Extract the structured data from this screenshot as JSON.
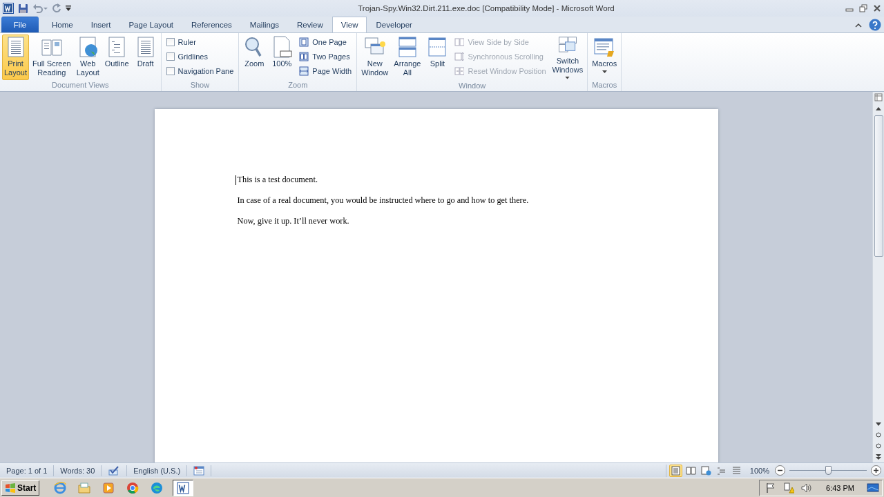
{
  "window": {
    "title": "Trojan-Spy.Win32.Dirt.211.exe.doc [Compatibility Mode]  -  Microsoft Word"
  },
  "tabs": [
    {
      "label": "File",
      "kind": "file",
      "selected": false
    },
    {
      "label": "Home",
      "kind": "tab",
      "selected": false
    },
    {
      "label": "Insert",
      "kind": "tab",
      "selected": false
    },
    {
      "label": "Page Layout",
      "kind": "tab",
      "selected": false
    },
    {
      "label": "References",
      "kind": "tab",
      "selected": false
    },
    {
      "label": "Mailings",
      "kind": "tab",
      "selected": false
    },
    {
      "label": "Review",
      "kind": "tab",
      "selected": false
    },
    {
      "label": "View",
      "kind": "tab",
      "selected": true
    },
    {
      "label": "Developer",
      "kind": "tab",
      "selected": false
    }
  ],
  "ribbon": {
    "groups": [
      {
        "label": "Document Views",
        "items": [
          {
            "kind": "large",
            "lines": [
              "Print",
              "Layout"
            ],
            "selected": true
          },
          {
            "kind": "large",
            "lines": [
              "Full Screen",
              "Reading"
            ],
            "selected": false
          },
          {
            "kind": "large",
            "lines": [
              "Web",
              "Layout"
            ],
            "selected": false
          },
          {
            "kind": "large",
            "lines": [
              "Outline"
            ],
            "selected": false
          },
          {
            "kind": "large",
            "lines": [
              "Draft"
            ],
            "selected": false
          }
        ]
      },
      {
        "label": "Show",
        "items": [
          {
            "kind": "check",
            "label": "Ruler",
            "checked": false
          },
          {
            "kind": "check",
            "label": "Gridlines",
            "checked": false
          },
          {
            "kind": "check",
            "label": "Navigation Pane",
            "checked": false
          }
        ]
      },
      {
        "label": "Zoom",
        "items": [
          {
            "kind": "large",
            "lines": [
              "Zoom"
            ],
            "selected": false
          },
          {
            "kind": "large",
            "lines": [
              "100%"
            ],
            "selected": false
          },
          {
            "kind": "small",
            "label": "One Page",
            "disabled": false
          },
          {
            "kind": "small",
            "label": "Two Pages",
            "disabled": false
          },
          {
            "kind": "small",
            "label": "Page Width",
            "disabled": false
          }
        ]
      },
      {
        "label": "Window",
        "items": [
          {
            "kind": "large",
            "lines": [
              "New",
              "Window"
            ],
            "selected": false
          },
          {
            "kind": "large",
            "lines": [
              "Arrange",
              "All"
            ],
            "selected": false
          },
          {
            "kind": "large",
            "lines": [
              "Split"
            ],
            "selected": false
          },
          {
            "kind": "small",
            "label": "View Side by Side",
            "disabled": true
          },
          {
            "kind": "small",
            "label": "Synchronous Scrolling",
            "disabled": true
          },
          {
            "kind": "small",
            "label": "Reset Window Position",
            "disabled": true
          },
          {
            "kind": "large",
            "lines": [
              "Switch",
              "Windows"
            ],
            "selected": false,
            "dropdown": true
          }
        ]
      },
      {
        "label": "Macros",
        "items": [
          {
            "kind": "large",
            "lines": [
              "Macros"
            ],
            "selected": false,
            "dropdown": true
          }
        ]
      }
    ]
  },
  "document": {
    "paragraphs": [
      "This is a test document.",
      "In case of a real  document, you would be instructed where to go and how to get there.",
      "Now,  give it up. It’ll never work."
    ]
  },
  "status_bar": {
    "page": "Page: 1 of 1",
    "words": "Words: 30",
    "language": "English (U.S.)",
    "views": [
      {
        "selected": true
      },
      {
        "selected": false
      },
      {
        "selected": false
      },
      {
        "selected": false
      },
      {
        "selected": false
      }
    ],
    "zoom": {
      "reading": "100%",
      "level": 0.5
    }
  },
  "taskbar": {
    "start": "Start",
    "apps": [
      {
        "selected": false
      },
      {
        "selected": false
      },
      {
        "selected": false
      },
      {
        "selected": false
      },
      {
        "selected": false
      },
      {
        "selected": true
      }
    ],
    "clock": "6:43 PM"
  }
}
